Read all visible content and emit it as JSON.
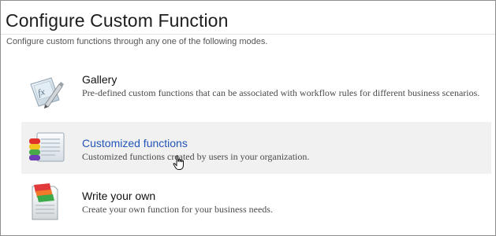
{
  "page": {
    "title": "Configure Custom Function",
    "subtitle": "Configure custom functions through any one of the following modes."
  },
  "options": [
    {
      "title": "Gallery",
      "description": "Pre-defined custom functions that can be associated with workflow rules for different business scenarios.",
      "icon": "gallery-fx-icon"
    },
    {
      "title": "Customized functions",
      "description": "Customized functions created by users in your organization.",
      "icon": "customized-functions-icon",
      "selected": true
    },
    {
      "title": "Write your own",
      "description": "Create your own function for your business needs.",
      "icon": "write-your-own-icon"
    }
  ],
  "colors": {
    "link": "#2255b8",
    "hover_bg": "#f1f1f1",
    "border": "#8e8e8e"
  }
}
